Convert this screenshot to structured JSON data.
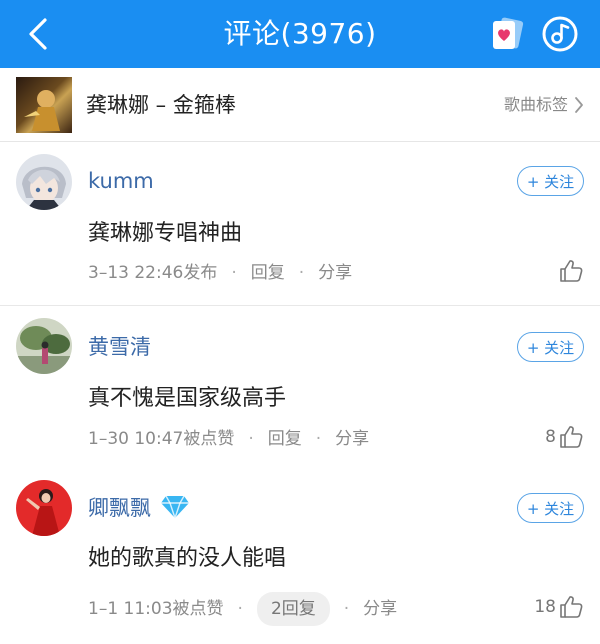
{
  "header": {
    "title": "评论(3976)",
    "accent": "#1a8ef2"
  },
  "song": {
    "title": "龚琳娜 – 金箍棒",
    "tag_label": "歌曲标签"
  },
  "comments": [
    {
      "user": "kumm",
      "follow_label": "+ 关注",
      "text": "龚琳娜专唱神曲",
      "time": "3–13 22:46发布",
      "reply_label": "回复",
      "share_label": "分享",
      "likes": ""
    },
    {
      "user": "黄雪清",
      "follow_label": "+ 关注",
      "text": "真不愧是国家级高手",
      "time": "1–30 10:47被点赞",
      "reply_label": "回复",
      "share_label": "分享",
      "likes": "8"
    },
    {
      "user": "卿飘飘",
      "follow_label": "+ 关注",
      "text": "她的歌真的没人能唱",
      "time": "1–1 11:03被点赞",
      "reply_label": "2回复",
      "share_label": "分享",
      "likes": "18"
    }
  ]
}
